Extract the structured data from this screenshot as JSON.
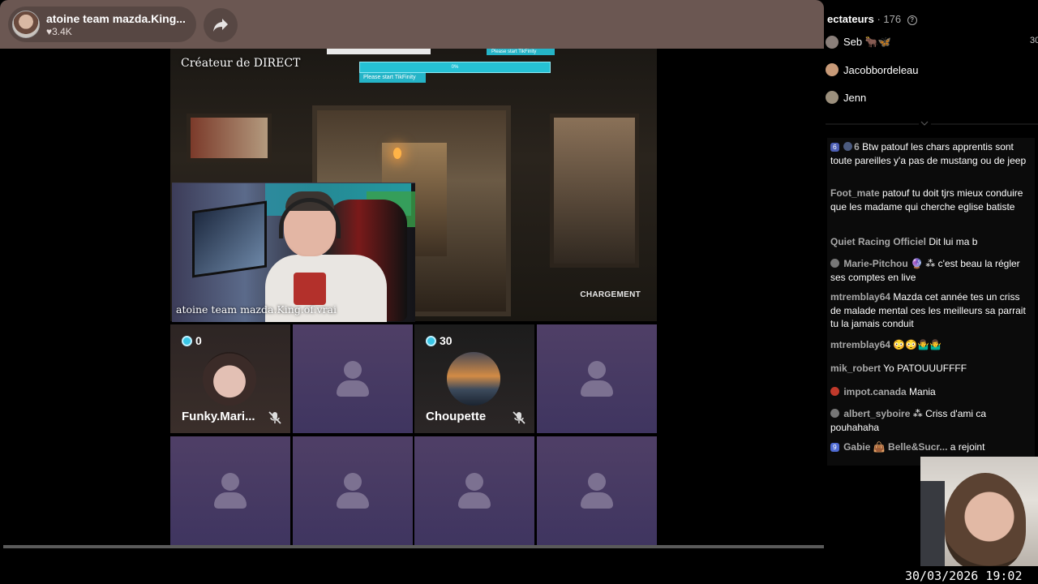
{
  "header": {
    "streamer_name": "atoine team mazda.King...",
    "likes": "3.4K",
    "share_icon": "share-arrow-icon"
  },
  "stream": {
    "creator_label": "Créateur de DIRECT",
    "webcam_name": "atoine team mazda.King.of.vrai",
    "loading_label": "CHARGEMENT",
    "game_overlay": {
      "strip_label": "Please start TikFinity",
      "progress_label": "0%",
      "progress_value": 0,
      "tag_label": "Please start TikFinity"
    }
  },
  "guests": [
    {
      "name": "Funky.Mari...",
      "coins": "0",
      "muted": true
    },
    {
      "name": "",
      "empty": true
    },
    {
      "name": "Choupette",
      "coins": "30",
      "muted": true
    },
    {
      "name": "",
      "empty": true
    },
    {
      "name": "",
      "empty": true
    },
    {
      "name": "",
      "empty": true
    },
    {
      "name": "",
      "empty": true
    },
    {
      "name": "",
      "empty": true
    }
  ],
  "viewers": {
    "title": "ectateurs",
    "count": "· 176",
    "list": [
      {
        "name": "Seb 🐂🦋",
        "score": "30"
      },
      {
        "name": "Jacobbordeleau"
      },
      {
        "name": "Jenn"
      }
    ]
  },
  "chat": [
    {
      "badge": "6",
      "badge2": "6",
      "user": "",
      "text": "Btw patouf les chars apprentis sont toute pareilles y'a pas de mustang ou de jeep"
    },
    {
      "user": "Foot_mate",
      "text": "patouf tu doit tjrs mieux conduire que les madame qui cherche eglise batiste"
    },
    {
      "user": "Quiet Racing Officiel",
      "text": "Dit lui ma b"
    },
    {
      "user": "Marie-Pitchou",
      "extra": "🔮 ⁂",
      "text": "c'est beau la régler ses comptes en live"
    },
    {
      "user": "mtremblay64",
      "text": "Mazda cet année tes un criss de malade mental ces les meilleurs sa parrait tu la jamais conduit"
    },
    {
      "user": "mtremblay64",
      "text": "😳😳🤷‍♂️🤷‍♂️"
    },
    {
      "user": "mik_robert",
      "text": "Yo PATOUUUFFFF"
    },
    {
      "user": "impot.canada",
      "text": "Mania"
    },
    {
      "user": "albert_syboire",
      "extra": "⁂",
      "text": "Criss d'ami ca pouhahaha"
    },
    {
      "badge": "9",
      "user": "Gabie 👜 Belle&Sucr...",
      "text": "a rejoint"
    }
  ],
  "clock": "30/03/2026 19:02"
}
